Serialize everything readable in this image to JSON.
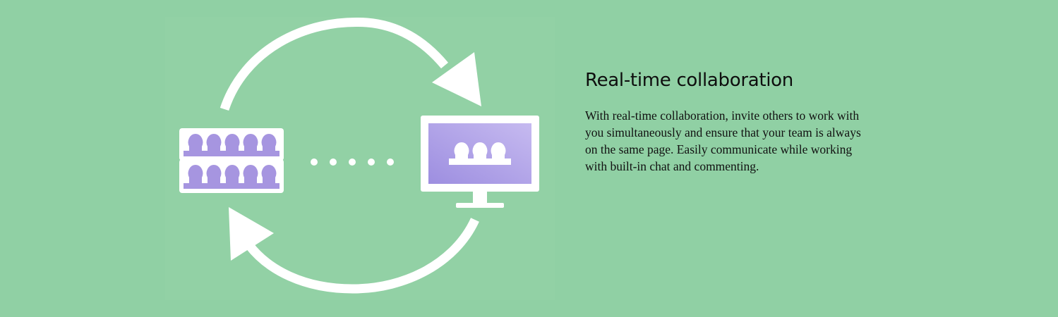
{
  "section": {
    "title": "Real-time collaboration",
    "description": "With real-time collaboration, invite others to work with you simultaneously and ensure that your team is always on the same page. Easily communicate while working with built-in chat and commenting."
  },
  "illustration": {
    "icons": [
      "sync-arrow-top-icon",
      "sync-arrow-bottom-icon",
      "team-group-icon",
      "connection-dots-icon",
      "monitor-icon",
      "remote-team-icon"
    ]
  },
  "colors": {
    "background": "#90d0a4",
    "illustration_panel": "#92d1a5",
    "foreground": "#ffffff",
    "accent_purple": "#a695e0",
    "accent_purple_light": "#c3b8ef",
    "text": "#111111"
  }
}
